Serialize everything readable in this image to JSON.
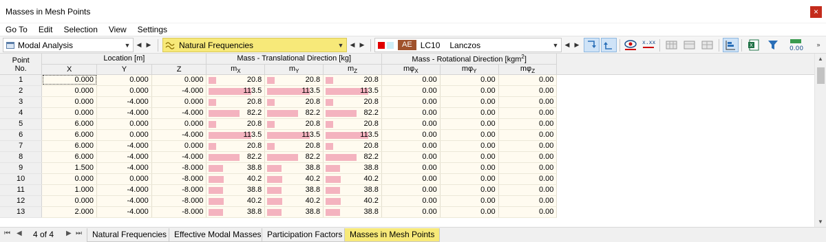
{
  "window": {
    "title": "Masses in Mesh Points",
    "close_glyph": "×"
  },
  "menu": [
    "Go To",
    "Edit",
    "Selection",
    "View",
    "Settings"
  ],
  "toolbar": {
    "analysis_combo": "Modal Analysis",
    "result_combo": "Natural Frequencies",
    "lc_badge": "AE",
    "lc_id": "LC10",
    "lc_method": "Lanczos",
    "highlight_color": "#f7e979",
    "icon_value_label": "0.00"
  },
  "columns": {
    "point_no_line1": "Point",
    "point_no_line2": "No.",
    "location_group": "Location [m]",
    "translational_group": "Mass - Translational Direction [kg]",
    "rotational_group_prefix": "Mass - Rotational Direction [kgm",
    "rotational_group_sup": "2",
    "rotational_group_suffix": "]",
    "x": "X",
    "y": "Y",
    "z": "Z",
    "mx": "mX",
    "my": "mY",
    "mz": "mZ",
    "mphix": "mφX",
    "mphiy": "mφY",
    "mphiz": "mφZ"
  },
  "bar_color": "#f4b3bf",
  "bar_max": 113.5,
  "rows": [
    {
      "no": "1",
      "x": "0.000",
      "y": "0.000",
      "z": "0.000",
      "mx": "20.8",
      "my": "20.8",
      "mz": "20.8",
      "rx": "0.00",
      "ry": "0.00",
      "rz": "0.00"
    },
    {
      "no": "2",
      "x": "0.000",
      "y": "0.000",
      "z": "-4.000",
      "mx": "113.5",
      "my": "113.5",
      "mz": "113.5",
      "rx": "0.00",
      "ry": "0.00",
      "rz": "0.00"
    },
    {
      "no": "3",
      "x": "0.000",
      "y": "-4.000",
      "z": "0.000",
      "mx": "20.8",
      "my": "20.8",
      "mz": "20.8",
      "rx": "0.00",
      "ry": "0.00",
      "rz": "0.00"
    },
    {
      "no": "4",
      "x": "0.000",
      "y": "-4.000",
      "z": "-4.000",
      "mx": "82.2",
      "my": "82.2",
      "mz": "82.2",
      "rx": "0.00",
      "ry": "0.00",
      "rz": "0.00"
    },
    {
      "no": "5",
      "x": "6.000",
      "y": "0.000",
      "z": "0.000",
      "mx": "20.8",
      "my": "20.8",
      "mz": "20.8",
      "rx": "0.00",
      "ry": "0.00",
      "rz": "0.00"
    },
    {
      "no": "6",
      "x": "6.000",
      "y": "0.000",
      "z": "-4.000",
      "mx": "113.5",
      "my": "113.5",
      "mz": "113.5",
      "rx": "0.00",
      "ry": "0.00",
      "rz": "0.00"
    },
    {
      "no": "7",
      "x": "6.000",
      "y": "-4.000",
      "z": "0.000",
      "mx": "20.8",
      "my": "20.8",
      "mz": "20.8",
      "rx": "0.00",
      "ry": "0.00",
      "rz": "0.00"
    },
    {
      "no": "8",
      "x": "6.000",
      "y": "-4.000",
      "z": "-4.000",
      "mx": "82.2",
      "my": "82.2",
      "mz": "82.2",
      "rx": "0.00",
      "ry": "0.00",
      "rz": "0.00"
    },
    {
      "no": "9",
      "x": "1.500",
      "y": "-4.000",
      "z": "-8.000",
      "mx": "38.8",
      "my": "38.8",
      "mz": "38.8",
      "rx": "0.00",
      "ry": "0.00",
      "rz": "0.00"
    },
    {
      "no": "10",
      "x": "0.000",
      "y": "0.000",
      "z": "-8.000",
      "mx": "40.2",
      "my": "40.2",
      "mz": "40.2",
      "rx": "0.00",
      "ry": "0.00",
      "rz": "0.00"
    },
    {
      "no": "11",
      "x": "1.000",
      "y": "-4.000",
      "z": "-8.000",
      "mx": "38.8",
      "my": "38.8",
      "mz": "38.8",
      "rx": "0.00",
      "ry": "0.00",
      "rz": "0.00"
    },
    {
      "no": "12",
      "x": "0.000",
      "y": "-4.000",
      "z": "-8.000",
      "mx": "40.2",
      "my": "40.2",
      "mz": "40.2",
      "rx": "0.00",
      "ry": "0.00",
      "rz": "0.00"
    },
    {
      "no": "13",
      "x": "2.000",
      "y": "-4.000",
      "z": "-8.000",
      "mx": "38.8",
      "my": "38.8",
      "mz": "38.8",
      "rx": "0.00",
      "ry": "0.00",
      "rz": "0.00"
    }
  ],
  "status": {
    "page": "4 of 4",
    "tabs": [
      "Natural Frequencies",
      "Effective Modal Masses",
      "Participation Factors",
      "Masses in Mesh Points"
    ],
    "active_tab": 3
  }
}
